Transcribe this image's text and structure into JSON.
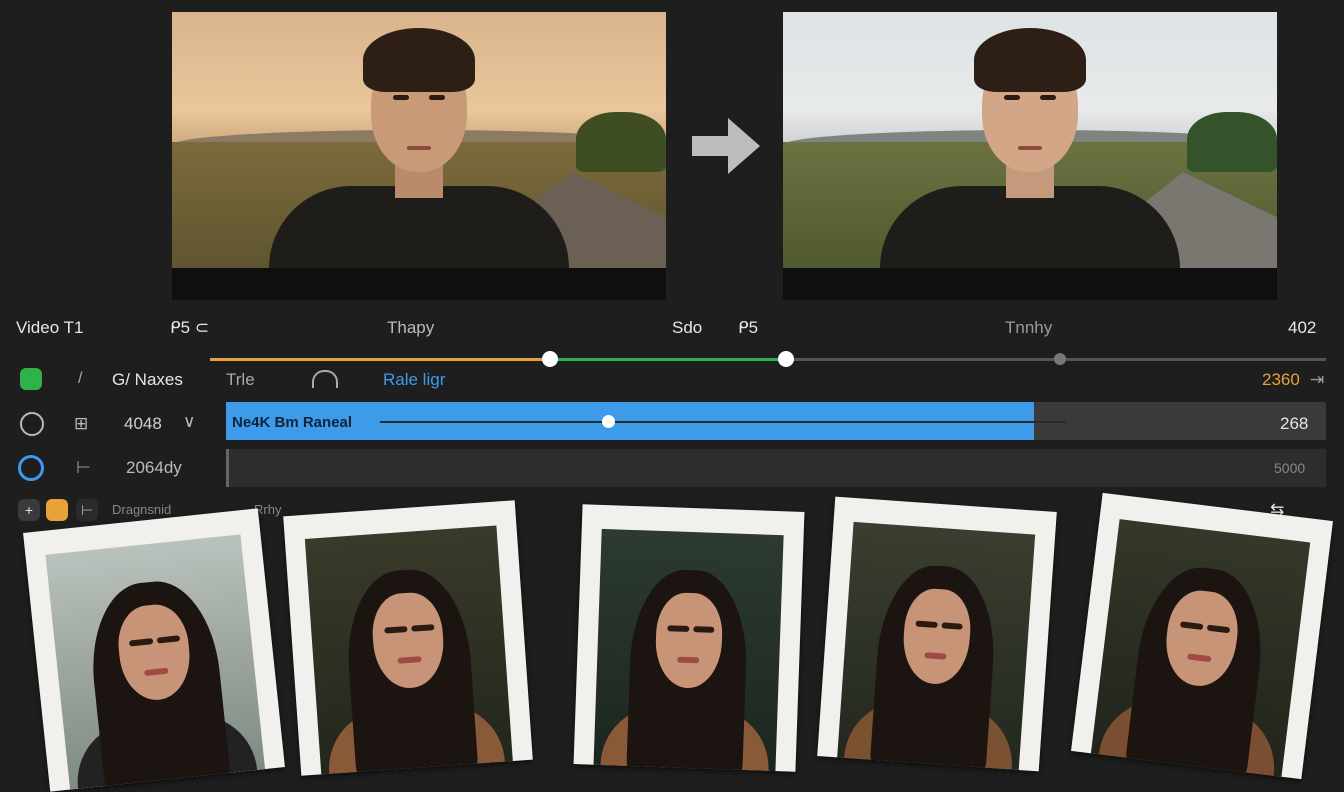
{
  "previews": {
    "before": {
      "caption": ""
    },
    "after": {
      "caption": ""
    }
  },
  "header_row": {
    "track_name": "Video T1",
    "col_a": "ᑭ5 ⊂",
    "col_b": "Thapy",
    "col_c": "Sdo",
    "col_d": "ᑭ5",
    "col_e": "Tnnhy",
    "col_f": "402"
  },
  "rows": [
    {
      "label": "G/ Naxes",
      "sub": "Trle",
      "tag": "Rale ligr",
      "value": "2360"
    },
    {
      "label": "4048",
      "clip_text": "Ne4K Bm Raneal",
      "value": "268"
    },
    {
      "label": "2064dy",
      "value": "5000"
    }
  ],
  "toolbar": {
    "item_label": "Dragnsnid",
    "item_label2": "Rrhy",
    "right_icon": "⇆"
  },
  "colors": {
    "accent_orange": "#e8a23a",
    "accent_green": "#2fb24a",
    "accent_blue": "#3d9be9"
  },
  "photos": [
    {
      "desc": ""
    },
    {
      "desc": ""
    },
    {
      "desc": ""
    },
    {
      "desc": ""
    },
    {
      "desc": ""
    }
  ]
}
